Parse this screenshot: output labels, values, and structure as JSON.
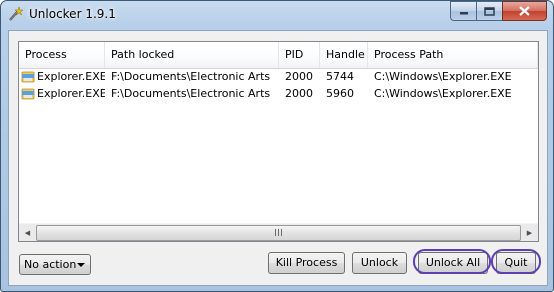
{
  "window": {
    "title": "Unlocker 1.9.1"
  },
  "titlebar_controls": {
    "minimize_icon": "minimize-icon",
    "maximize_icon": "maximize-icon",
    "close_icon": "close-icon"
  },
  "table": {
    "columns": [
      "Process",
      "Path locked",
      "PID",
      "Handle",
      "Process Path"
    ],
    "rows": [
      {
        "process": "Explorer.EXE",
        "path_locked": "F:\\Documents\\Electronic Arts",
        "pid": "2000",
        "handle": "5744",
        "process_path": "C:\\Windows\\Explorer.EXE"
      },
      {
        "process": "Explorer.EXE",
        "path_locked": "F:\\Documents\\Electronic Arts",
        "pid": "2000",
        "handle": "5960",
        "process_path": "C:\\Windows\\Explorer.EXE"
      }
    ]
  },
  "action_select": {
    "selected": "No action"
  },
  "buttons": {
    "kill_process": "Kill Process",
    "unlock": "Unlock",
    "unlock_all": "Unlock All",
    "quit": "Quit"
  },
  "colors": {
    "highlight_ring": "#5b3fb3",
    "titlebar": "#b7cfe8",
    "close_button": "#c0412c"
  }
}
